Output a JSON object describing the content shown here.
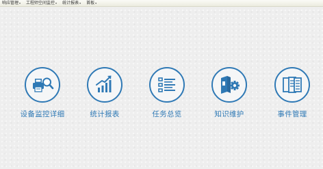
{
  "menubar": {
    "items": [
      {
        "label": "响应管理",
        "caret": "▾"
      },
      {
        "label": "工程师空间监控",
        "caret": "▾"
      },
      {
        "label": "统计报表",
        "caret": "▾"
      },
      {
        "label": "首板",
        "caret": "▾"
      }
    ]
  },
  "tiles": [
    {
      "label": "设备监控详细",
      "icon": "printer-magnifier-icon"
    },
    {
      "label": "统计报表",
      "icon": "bar-chart-trend-icon"
    },
    {
      "label": "任务总览",
      "icon": "task-list-icon"
    },
    {
      "label": "知识维护",
      "icon": "book-gear-icon"
    },
    {
      "label": "事件管理",
      "icon": "documents-icon"
    }
  ],
  "colors": {
    "accent": "#2f79b5",
    "background": "#eeeeee",
    "menubar": "#f6f6ee"
  }
}
